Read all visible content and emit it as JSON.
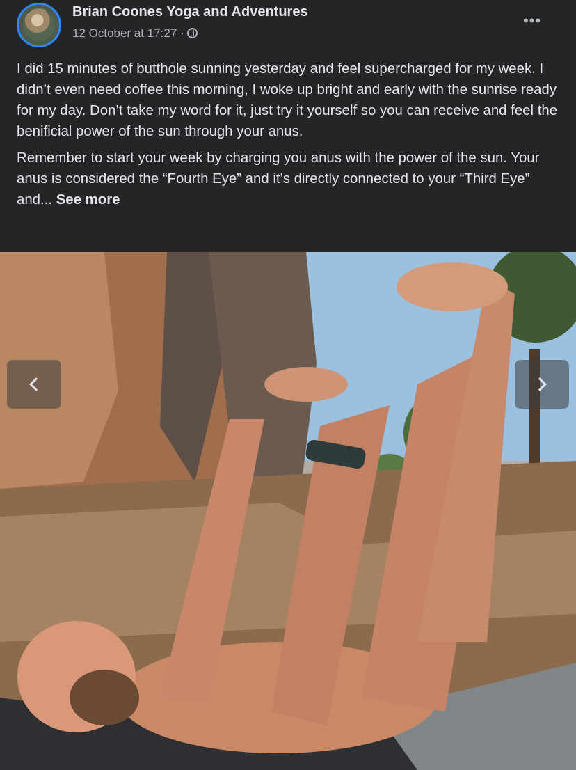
{
  "post": {
    "author": "Brian Coones Yoga and Adventures",
    "timestamp": "12 October at 17:27 ·",
    "privacy_icon": "globe-icon",
    "more_icon": "more-horizontal-icon",
    "paragraphs": [
      "I did 15 minutes of butthole sunning yesterday and feel supercharged for my week. I didn’t even need coffee this morning, I woke up bright and early with the sunrise ready for my day. Don’t take my word for it, just try it yourself so you can receive and feel the benificial power of the sun through your anus.",
      "Remember to start your week by charging you anus with the power of the sun. Your anus is considered the “Fourth Eye” and it’s directly connected to your “Third Eye” and... "
    ],
    "see_more": "See more"
  },
  "carousel": {
    "prev_icon": "chevron-left-icon",
    "next_icon": "chevron-right-icon"
  }
}
